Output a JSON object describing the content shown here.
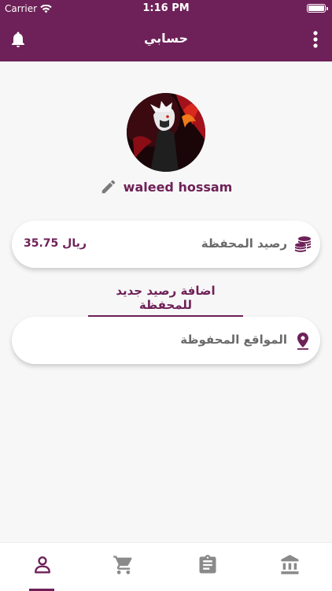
{
  "status_bar": {
    "carrier": "Carrier",
    "time": "1:16 PM"
  },
  "app_bar": {
    "title": "حسابي"
  },
  "profile": {
    "name": "waleed hossam"
  },
  "wallet": {
    "label": "رصيد المحفظة",
    "amount": "35.75 ريال"
  },
  "add_balance": {
    "label": "اضافة رصيد جديد للمحفظة"
  },
  "saved_locations": {
    "label": "المواقع المحفوظة"
  },
  "colors": {
    "primary": "#6e2158",
    "text_gray": "#6a6a6a",
    "icon_gray": "#7a7a7a"
  },
  "tabs": [
    {
      "icon": "person-icon",
      "active": true
    },
    {
      "icon": "cart-icon",
      "active": false
    },
    {
      "icon": "clipboard-icon",
      "active": false
    },
    {
      "icon": "bank-icon",
      "active": false
    }
  ]
}
